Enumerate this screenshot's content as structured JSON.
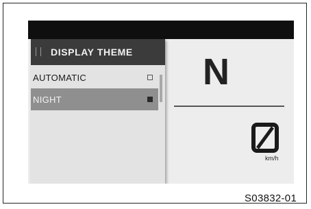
{
  "menu": {
    "title": "DISPLAY THEME",
    "items": [
      {
        "label": "AUTOMATIC",
        "selected": false
      },
      {
        "label": "NIGHT",
        "selected": true
      }
    ]
  },
  "dash": {
    "gear": "N",
    "speed": "0",
    "speed_unit": "km/h"
  },
  "figure_code": "S03832-01",
  "colors": {
    "top_bar": "#0f0f0f",
    "header": "#3b3b3b",
    "selected_row": "#8f8f8f",
    "screen_bg": "#ededed"
  },
  "icons": {
    "handle": "drag-handle-icon",
    "unchecked": "empty-square-icon",
    "checked": "filled-square-icon"
  }
}
